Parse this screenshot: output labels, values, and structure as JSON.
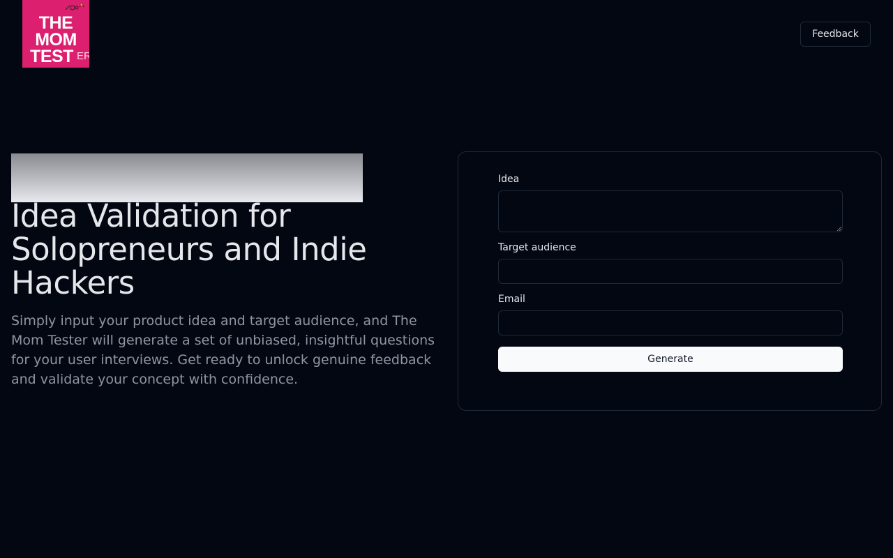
{
  "header": {
    "logo": {
      "line1": "THE",
      "line2": "MOM",
      "line3": "TEST",
      "line3_suffix": "ER",
      "background": "#dc1f6e"
    },
    "feedback_label": "Feedback"
  },
  "hero": {
    "title": "Idea Validation for Solopreneurs and Indie Hackers",
    "description": "Simply input your product idea and target audience, and The Mom Tester will generate a set of unbiased, insightful questions for your user interviews. Get ready to unlock genuine feedback and validate your concept with confidence."
  },
  "form": {
    "idea_label": "Idea",
    "idea_value": "",
    "audience_label": "Target audience",
    "audience_value": "",
    "email_label": "Email",
    "email_value": "",
    "submit_label": "Generate"
  },
  "colors": {
    "background": "#030712",
    "border": "#1f2937",
    "button_primary": "#f9fafb",
    "logo_pink": "#dc1f6e"
  }
}
